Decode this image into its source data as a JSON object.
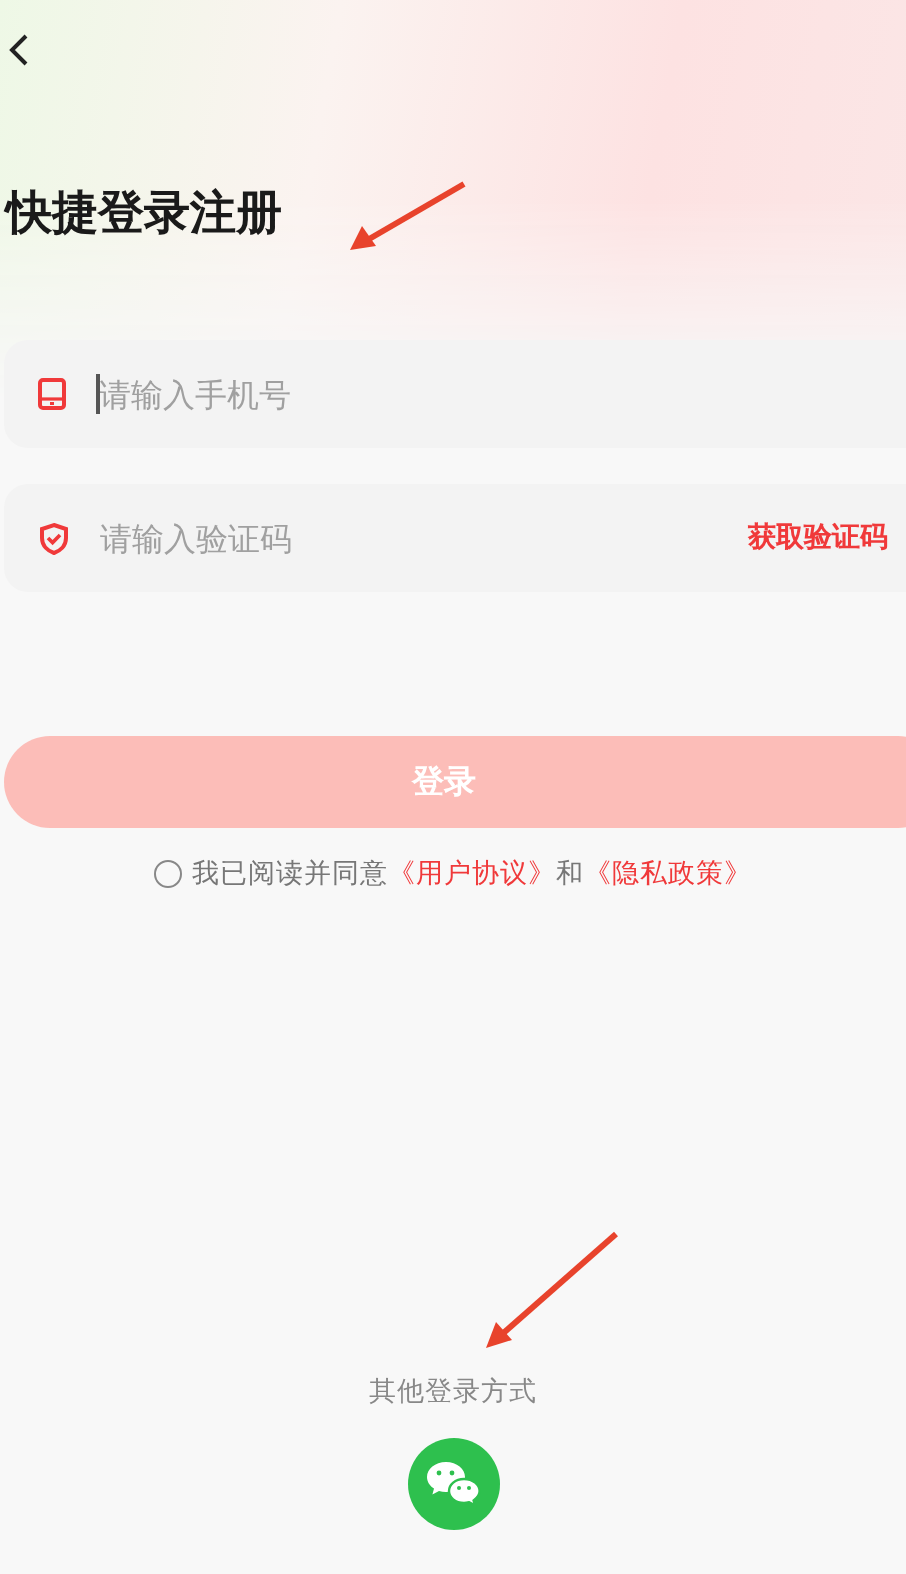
{
  "title": "快捷登录注册",
  "phone": {
    "placeholder": "请输入手机号",
    "focused": true
  },
  "code": {
    "placeholder": "请输入验证码",
    "action": "获取验证码"
  },
  "login": {
    "label": "登录",
    "disabled": true
  },
  "agreement": {
    "checked": false,
    "text": "我已阅读并同意",
    "link1": "《用户协议》",
    "joiner": "和",
    "link2": "《隐私政策》"
  },
  "other_login": {
    "label": "其他登录方式"
  }
}
